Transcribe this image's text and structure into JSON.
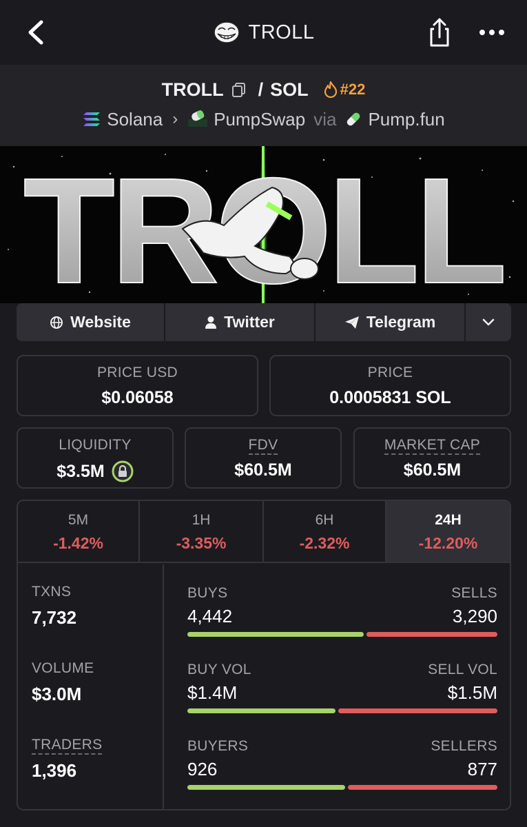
{
  "header": {
    "title": "TROLL"
  },
  "pair": {
    "base": "TROLL",
    "separator": "/",
    "quote": "SOL",
    "rank": "#22"
  },
  "breadcrumb": {
    "chain": "Solana",
    "dex": "PumpSwap",
    "via": "via",
    "launchpad": "Pump.fun"
  },
  "socials": {
    "website": "Website",
    "twitter": "Twitter",
    "telegram": "Telegram"
  },
  "price": {
    "usd_label": "PRICE USD",
    "usd_value": "$0.06058",
    "native_label": "PRICE",
    "native_value": "0.0005831 SOL"
  },
  "metrics": {
    "liquidity_label": "LIQUIDITY",
    "liquidity_value": "$3.5M",
    "fdv_label": "FDV",
    "fdv_value": "$60.5M",
    "mcap_label": "MARKET CAP",
    "mcap_value": "$60.5M"
  },
  "timeframes": [
    {
      "label": "5M",
      "change": "-1.42%"
    },
    {
      "label": "1H",
      "change": "-3.35%"
    },
    {
      "label": "6H",
      "change": "-2.32%"
    },
    {
      "label": "24H",
      "change": "-12.20%"
    }
  ],
  "stats": {
    "txns_label": "TXNS",
    "txns_value": "7,732",
    "volume_label": "VOLUME",
    "volume_value": "$3.0M",
    "traders_label": "TRADERS",
    "traders_value": "1,396",
    "buys_label": "BUYS",
    "buys_value": "4,442",
    "sells_label": "SELLS",
    "sells_value": "3,290",
    "buyvol_label": "BUY VOL",
    "buyvol_value": "$1.4M",
    "sellvol_label": "SELL VOL",
    "sellvol_value": "$1.5M",
    "buyers_label": "BUYERS",
    "buyers_value": "926",
    "sellers_label": "SELLERS",
    "sellers_value": "877"
  },
  "ratios": {
    "buys_sells": [
      4442,
      3290
    ],
    "buyvol_sellvol": [
      1.4,
      1.5
    ],
    "buyers_sellers": [
      926,
      877
    ]
  },
  "banner": {
    "text": "TROLL"
  },
  "colors": {
    "background": "#1b1b1f",
    "buy": "#a8d36b",
    "sell": "#e05d5d",
    "rank": "#f5a13a",
    "muted": "#a3a3ab"
  },
  "icons": {
    "back": "chevron-left-icon",
    "share": "share-icon",
    "more": "ellipsis-icon",
    "copy": "copy-icon",
    "rank": "flame-icon",
    "chain": "solana-icon",
    "dex": "pumpswap-icon",
    "launchpad": "pill-icon",
    "website": "globe-icon",
    "twitter": "person-icon",
    "telegram": "paper-plane-icon",
    "expand": "chevron-down-icon",
    "lock": "lock-icon"
  }
}
